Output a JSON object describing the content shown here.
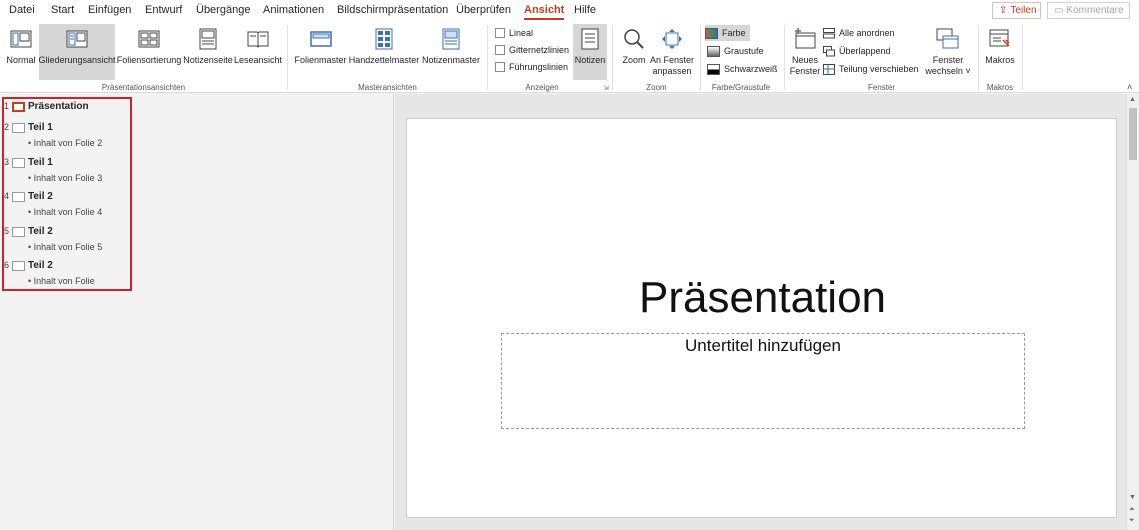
{
  "tabs": [
    "Datei",
    "Start",
    "Einfügen",
    "Entwurf",
    "Übergänge",
    "Animationen",
    "Bildschirmpräsentation",
    "Überprüfen",
    "Ansicht",
    "Hilfe"
  ],
  "active_tab": "Ansicht",
  "share_label": "Teilen",
  "comments_label": "Kommentare",
  "groups": {
    "presentation_views": {
      "caption": "Präsentationsansichten",
      "buttons": [
        "Normal",
        "Gliederungsansicht",
        "Foliensortierung",
        "Notizenseite",
        "Leseansicht"
      ]
    },
    "master_views": {
      "caption": "Masteransichten",
      "buttons": [
        "Folienmaster",
        "Handzettelmaster",
        "Notizenmaster"
      ]
    },
    "show": {
      "caption": "Anzeigen",
      "checks": [
        "Lineal",
        "Gitternetzlinien",
        "Führungslinien"
      ],
      "notes": "Notizen"
    },
    "zoom": {
      "caption": "Zoom",
      "zoom": "Zoom",
      "fit_1": "An Fenster",
      "fit_2": "anpassen"
    },
    "color": {
      "caption": "Farbe/Graustufe",
      "items": [
        "Farbe",
        "Graustufe",
        "Schwarzweiß"
      ]
    },
    "window": {
      "caption": "Fenster",
      "new_1": "Neues",
      "new_2": "Fenster",
      "items": [
        "Alle anordnen",
        "Überlappend",
        "Teilung verschieben"
      ],
      "switch_1": "Fenster",
      "switch_2": "wechseln"
    },
    "macros": {
      "caption": "Makros",
      "button": "Makros"
    }
  },
  "outline": [
    {
      "num": "1",
      "title": "Präsentation",
      "body": ""
    },
    {
      "num": "2",
      "title": "Teil 1",
      "body": "• Inhalt von Folie 2"
    },
    {
      "num": "3",
      "title": "Teil 1",
      "body": "• Inhalt von Folie 3"
    },
    {
      "num": "4",
      "title": "Teil 2",
      "body": "• Inhalt von Folie 4"
    },
    {
      "num": "5",
      "title": "Teil 2",
      "body": "• Inhalt von Folie 5"
    },
    {
      "num": "6",
      "title": "Teil 2",
      "body": "• Inhalt von Folie"
    }
  ],
  "slide": {
    "title": "Präsentation",
    "subtitle_placeholder": "Untertitel hinzufügen"
  },
  "colors": {
    "accent": "#c43e1c",
    "highlight_box": "#d32028"
  }
}
